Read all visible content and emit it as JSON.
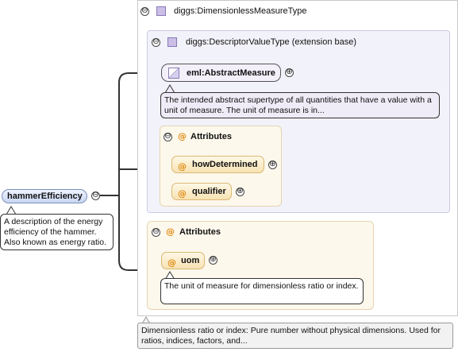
{
  "root": {
    "name": "hammerEfficiency",
    "doc": "A description of the energy efficiency of the hammer. Also known as energy ratio."
  },
  "type_panel": {
    "title": "diggs:DimensionlessMeasureType",
    "doc": "Dimensionless ratio or index: Pure number without physical dimensions. Used for ratios, indices, factors, and..."
  },
  "base_panel": {
    "title": "diggs:DescriptorValueType (extension base)"
  },
  "abstract_measure": {
    "name": "eml:AbstractMeasure",
    "doc": "The intended abstract supertype of all quantities that have a value with a unit of measure. The unit of measure is in..."
  },
  "base_attributes": {
    "title": "Attributes",
    "items": [
      {
        "name": "howDetermined"
      },
      {
        "name": "qualifier"
      }
    ]
  },
  "type_attributes": {
    "title": "Attributes",
    "items": [
      {
        "name": "uom",
        "doc": "The unit of measure for dimensionless ratio or index."
      }
    ]
  },
  "glyphs": {
    "collapse": "⊖",
    "expand": "⊕",
    "at": "@"
  },
  "colors": {
    "node_blue": "#c9d6f2",
    "type_icon": "#cbbfe8",
    "attr_icon": "#e08a10",
    "connector": "#333333"
  }
}
